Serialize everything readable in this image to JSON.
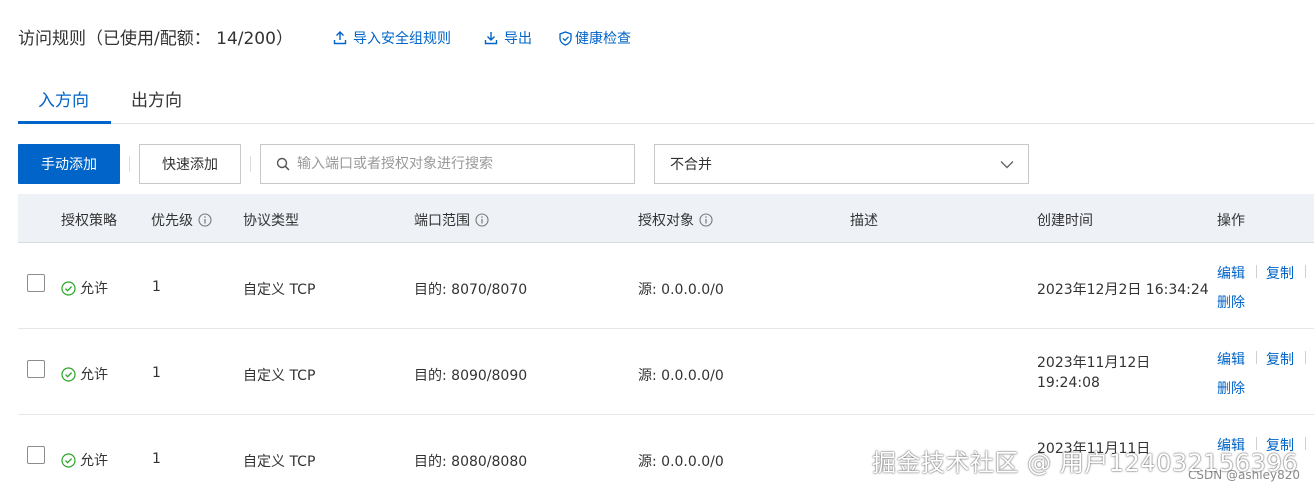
{
  "header": {
    "title": "访问规则（已使用/配额： 14/200）",
    "import_label": "导入安全组规则",
    "export_label": "导出",
    "health_label": "健康检查"
  },
  "tabs": [
    {
      "label": "入方向",
      "active": true
    },
    {
      "label": "出方向",
      "active": false
    }
  ],
  "toolbar": {
    "manual_add_label": "手动添加",
    "quick_add_label": "快速添加",
    "search_placeholder": "输入端口或者授权对象进行搜索",
    "merge_select_value": "不合并"
  },
  "table": {
    "columns": [
      "授权策略",
      "优先级",
      "协议类型",
      "端口范围",
      "授权对象",
      "描述",
      "创建时间",
      "操作"
    ],
    "rows": [
      {
        "policy": "允许",
        "priority": "1",
        "protocol": "自定义 TCP",
        "port": "目的: 8070/8070",
        "source": "源: 0.0.0.0/0",
        "desc": "",
        "created_line1": "2023年12月2日 16:34:24",
        "created_line2": "",
        "edit": "编辑",
        "copy": "复制",
        "delete": "删除"
      },
      {
        "policy": "允许",
        "priority": "1",
        "protocol": "自定义 TCP",
        "port": "目的: 8090/8090",
        "source": "源: 0.0.0.0/0",
        "desc": "",
        "created_line1": "2023年11月12日",
        "created_line2": "19:24:08",
        "edit": "编辑",
        "copy": "复制",
        "delete": "删除"
      },
      {
        "policy": "允许",
        "priority": "1",
        "protocol": "自定义 TCP",
        "port": "目的: 8080/8080",
        "source": "源: 0.0.0.0/0",
        "desc": "",
        "created_line1": "2023年11月11日",
        "created_line2": "",
        "edit": "编辑",
        "copy": "复制",
        "delete": ""
      }
    ]
  },
  "watermark": {
    "text": "掘金技术社区 @ 用户124032156396",
    "small_text": "CSDN @ashley820"
  },
  "colors": {
    "accent": "#0064c8",
    "success": "#2aa52a",
    "header_bg": "#eef2f7"
  }
}
